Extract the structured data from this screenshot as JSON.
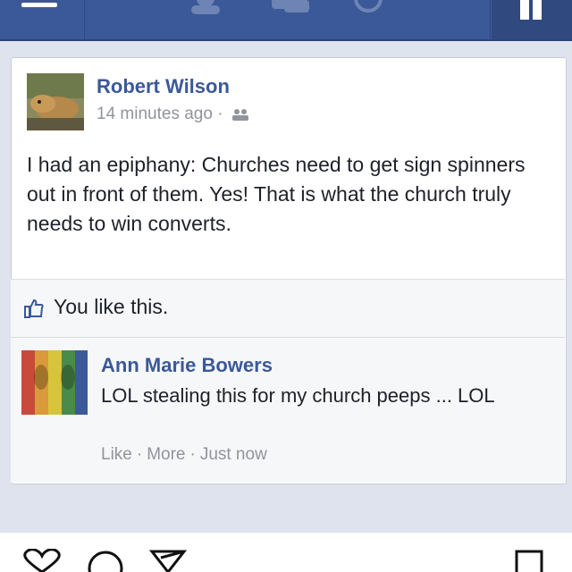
{
  "post": {
    "author": "Robert Wilson",
    "timestamp": "14 minutes ago",
    "separator": "·",
    "privacy_icon": "friends-icon",
    "text": "I had an epiphany: Churches need to get sign spinners out in front of them. Yes! That is what the church truly needs to win converts."
  },
  "likes": {
    "icon": "thumbs-up-icon",
    "text": "You like this."
  },
  "comment": {
    "author": "Ann Marie Bowers",
    "text": "LOL stealing this for my church peeps ... LOL",
    "actions": {
      "like": "Like",
      "more": "More",
      "time": "Just now",
      "sep": "·"
    }
  },
  "colors": {
    "brand": "#3b5998",
    "meta": "#90949c",
    "background": "#dfe3ee"
  },
  "bottom_bar": {
    "icons": [
      "heart-icon",
      "comment-icon",
      "share-icon",
      "bookmark-icon"
    ]
  }
}
